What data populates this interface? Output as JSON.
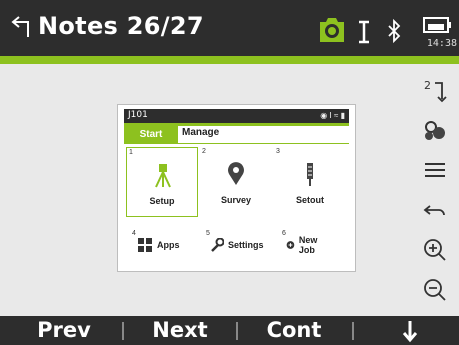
{
  "titlebar": {
    "title": "Notes 26/27",
    "time": "14:38"
  },
  "preview": {
    "header_title": "J101",
    "tabs": [
      "Start",
      "Manage"
    ],
    "tiles": [
      {
        "number": "1",
        "label": "Setup",
        "icon": "tripod-icon"
      },
      {
        "number": "2",
        "label": "Survey",
        "icon": "location-pin-icon"
      },
      {
        "number": "3",
        "label": "Setout",
        "icon": "stakeout-pole-icon"
      }
    ],
    "row2": [
      {
        "number": "4",
        "label": "Apps",
        "icon": "apps-grid-icon"
      },
      {
        "number": "5",
        "label": "Settings",
        "icon": "wrench-icon"
      },
      {
        "number": "6",
        "label": "New Job",
        "icon": "new-job-icon"
      }
    ]
  },
  "tools": [
    "text-position-icon",
    "group-icon",
    "menu-lines-icon",
    "undo-arrow-icon",
    "zoom-in-icon",
    "zoom-out-icon"
  ],
  "softkeys": {
    "prev": "Prev",
    "next": "Next",
    "cont": "Cont"
  },
  "colors": {
    "accent": "#8dc11f",
    "bar": "#2d2d2d",
    "background": "#e9e9e9"
  }
}
